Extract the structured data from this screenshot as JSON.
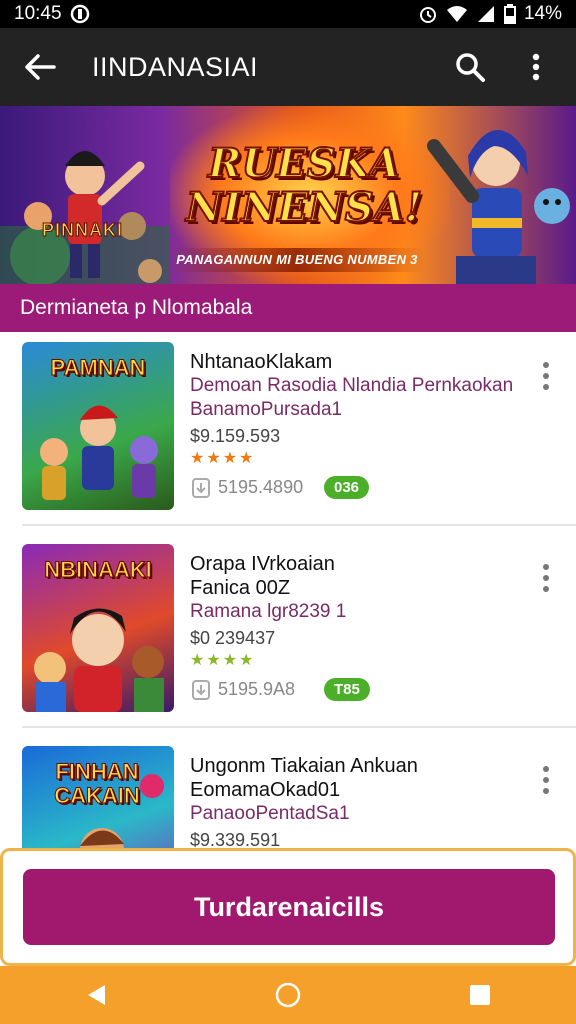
{
  "status_bar": {
    "time": "10:45",
    "battery": "14%"
  },
  "app_bar": {
    "title": "IINDANASIAI"
  },
  "banner": {
    "small_logo": "PINNAKI",
    "headline_line1": "RUESKA",
    "headline_line2": "NINENSA!",
    "tagline": "PANAGANNUN MI BUENG NUMBEN 3"
  },
  "section": {
    "title": "Dermianeta p Nlomabala"
  },
  "items": [
    {
      "thumb_label": "PAMNAN",
      "name": "NhtanaoKlakam",
      "desc1": "Demoan Rasodia Nlandia Pernkaokan",
      "desc2": "BanamoPursada1",
      "price": "$9.159.593",
      "stars": "★★★★",
      "meta": "5195.4890",
      "badge": "036"
    },
    {
      "thumb_label": "NBINAAKI",
      "name": "Orapa IVrkoaian",
      "desc1": "Fanica 00Z",
      "desc2": "Ramana lgr8239 1",
      "price": "$0 239437",
      "stars": "★★★★",
      "meta": "5195.9A8",
      "badge": "T85"
    },
    {
      "thumb_label": "FINHAN CAKAIN",
      "name": "Ungonm Tiakaian Ankuan",
      "desc1": "EomamaOkad01",
      "desc2": "PanaooPentadSa1",
      "price": "$9.339.591",
      "stars": "",
      "meta": "",
      "badge": ""
    }
  ],
  "cta": {
    "label": "Turdarenaicills"
  },
  "colors": {
    "accent": "#9c1a78",
    "cta": "#a0196e",
    "nav_bar": "#f5a02a",
    "badge": "#4caf2a",
    "app_bar": "#232323"
  },
  "icons": {
    "back": "arrow-left-icon",
    "search": "search-icon",
    "more": "more-vert-icon",
    "nav_back": "triangle-back-icon",
    "nav_home": "circle-home-icon",
    "nav_recents": "square-recents-icon"
  }
}
